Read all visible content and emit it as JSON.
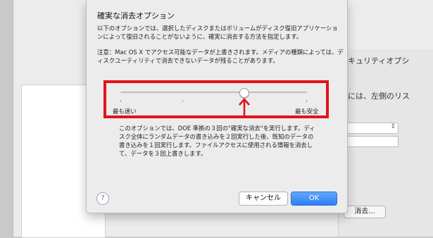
{
  "background": {
    "partial_text_1": "キュリティオプシ",
    "partial_text_2": "には、左側のリス",
    "erase_button_label": "消去..."
  },
  "dialog": {
    "title": "確実な消去オプション",
    "description": "以下のオプションでは、選択したディスクまたはボリュームがディスク復旧アプリケーションによって復旧されることがないように、確実に消去する方法を指定します。",
    "note": "注意：Mac OS X でアクセス可能なデータが上書きされます。メディアの種類によっては、ディスクユーティリティで消去できないデータが残ることがあります。",
    "slider": {
      "min_label": "最も速い",
      "max_label": "最も安全",
      "level": 0.67
    },
    "option_description": "このオプションでは、DOE 準拠の３回の\"確実な消去\"を実行します。ディスク全体にランダムデータの書き込みを２回実行した後、既知のデータの書き込みを１回実行します。ファイルアクセスに使用される情報を消去して、データを３回上書きします。",
    "help_label": "?",
    "cancel_label": "キャンセル",
    "ok_label": "OK"
  },
  "annotation": {
    "highlight_color": "#e1141a",
    "arrow_color": "#e1141a"
  },
  "colors": {
    "accent": "#2b7ef5",
    "sheet_background": "#ececec"
  }
}
